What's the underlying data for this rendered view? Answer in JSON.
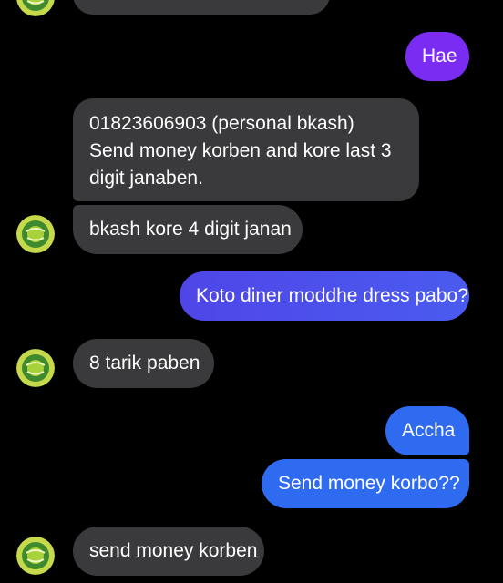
{
  "conversation": {
    "messages": [
      {
        "id": "m0",
        "direction": "incoming",
        "text": ""
      },
      {
        "id": "m1",
        "direction": "outgoing",
        "text": "Hae"
      },
      {
        "id": "m2",
        "direction": "incoming",
        "lines": [
          "01823606903  (personal bkash)",
          "Send money korben and kore last 3",
          "digit janaben."
        ]
      },
      {
        "id": "m3",
        "direction": "incoming",
        "text": "bkash kore 4 digit janan"
      },
      {
        "id": "m4",
        "direction": "outgoing",
        "text": "Koto diner moddhe dress pabo?"
      },
      {
        "id": "m5",
        "direction": "incoming",
        "text": "8 tarik paben"
      },
      {
        "id": "m6",
        "direction": "outgoing",
        "text": "Accha"
      },
      {
        "id": "m7",
        "direction": "outgoing",
        "text": "Send money korbo??"
      },
      {
        "id": "m8",
        "direction": "incoming",
        "text": "send money korben"
      }
    ]
  },
  "theme": {
    "background": "#000000",
    "incoming_bubble": "#3a3a3c",
    "outgoing_violet": "#7b2cf2",
    "outgoing_indigo": "#4f46e8",
    "outgoing_blue": "#2e6bf0",
    "avatar_icon": "sender-avatar-icon"
  }
}
